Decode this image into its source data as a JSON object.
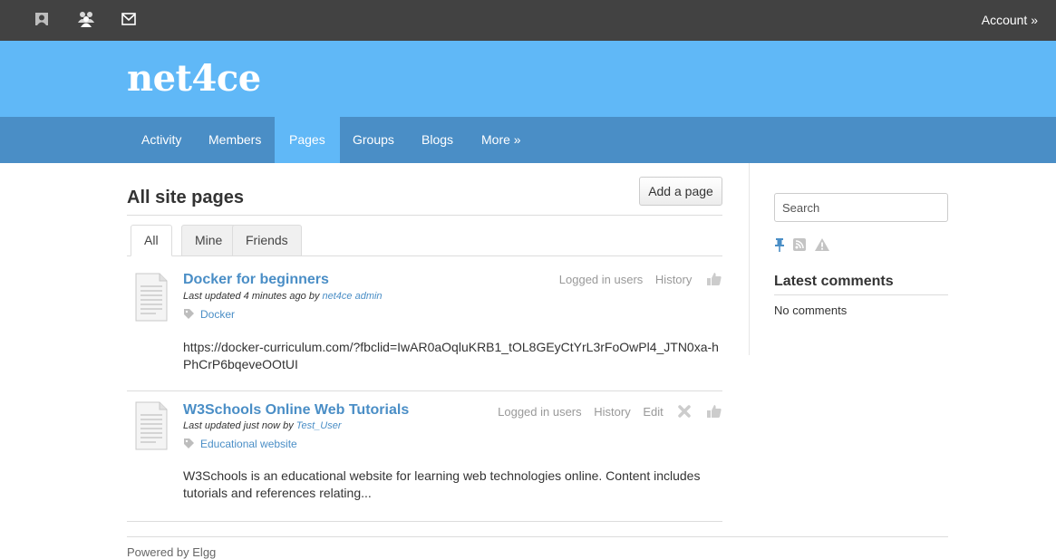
{
  "topbar": {
    "icons": [
      "profile-icon",
      "friends-icon",
      "messages-icon"
    ],
    "account_label": "Account »"
  },
  "site": {
    "name": "net4ce",
    "brand_color": "#60b8f7",
    "nav_color": "#4a8ec6"
  },
  "nav": {
    "items": [
      {
        "label": "Activity"
      },
      {
        "label": "Members"
      },
      {
        "label": "Pages",
        "active": true
      },
      {
        "label": "Groups"
      },
      {
        "label": "Blogs"
      },
      {
        "label": "More »"
      }
    ]
  },
  "main": {
    "title": "All site pages",
    "add_button": "Add a page",
    "tabs": [
      {
        "label": "All",
        "active": true
      },
      {
        "label": "Mine"
      },
      {
        "label": "Friends"
      }
    ],
    "entries": [
      {
        "title": "Docker for beginners",
        "updated_prefix": "Last updated 4 minutes ago by ",
        "author": "net4ce admin",
        "tag": "Docker",
        "description": "https://docker-curriculum.com/?fbclid=IwAR0aOqluKRB1_tOL8GEyCtYrL3rFoOwPl4_JTN0xa-hPhCrP6bqeveOOtUI",
        "meta": {
          "access": "Logged in users",
          "history": "History"
        }
      },
      {
        "title": "W3Schools Online Web Tutorials",
        "updated_prefix": "Last updated just now by ",
        "author": "Test_User",
        "tag": "Educational website",
        "description": "W3Schools is an educational website for learning web technologies online. Content includes tutorials and references relating...",
        "meta": {
          "access": "Logged in users",
          "history": "History",
          "edit": "Edit"
        }
      }
    ]
  },
  "sidebar": {
    "search_placeholder": "Search",
    "icons": [
      "pin-icon",
      "rss-icon",
      "report-icon"
    ],
    "latest_comments_title": "Latest comments",
    "no_comments": "No comments"
  },
  "footer": {
    "text": "Powered by Elgg"
  }
}
